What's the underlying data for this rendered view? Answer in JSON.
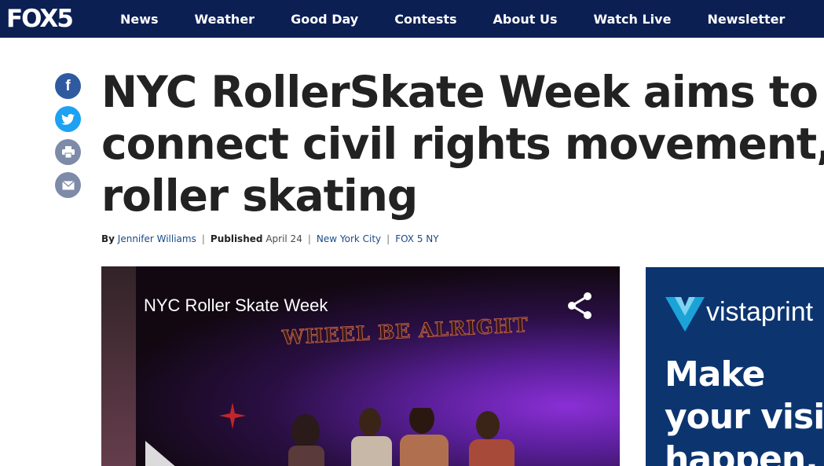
{
  "nav": {
    "logo": "FOX5",
    "links": [
      "News",
      "Weather",
      "Good Day",
      "Contests",
      "About Us",
      "Watch Live",
      "Newsletter"
    ]
  },
  "share": {
    "icons": [
      "facebook-icon",
      "twitter-icon",
      "print-icon",
      "email-icon"
    ],
    "facebook_label": "f"
  },
  "article": {
    "headline_lines": [
      "NYC RollerSkate Week aims to",
      "connect civil rights movement,",
      "roller skating"
    ],
    "byline": {
      "by_label": "By",
      "author": "Jennifer Williams",
      "published_label": "Published",
      "date": "April 24",
      "location": "New York City",
      "source": "FOX 5 NY"
    }
  },
  "video": {
    "title": "NYC Roller Skate Week",
    "sign_text": "WHEEL BE ALRIGHT"
  },
  "ad": {
    "brand": "vistaprint",
    "lines": [
      "Make",
      "your visio",
      "happen."
    ]
  },
  "colors": {
    "nav_bg": "#0b1f53",
    "share_facebook": "#2f5aa0",
    "share_twitter": "#1da1f2",
    "share_grey": "#7d8aa8",
    "ad_bg": "#0c3570"
  }
}
